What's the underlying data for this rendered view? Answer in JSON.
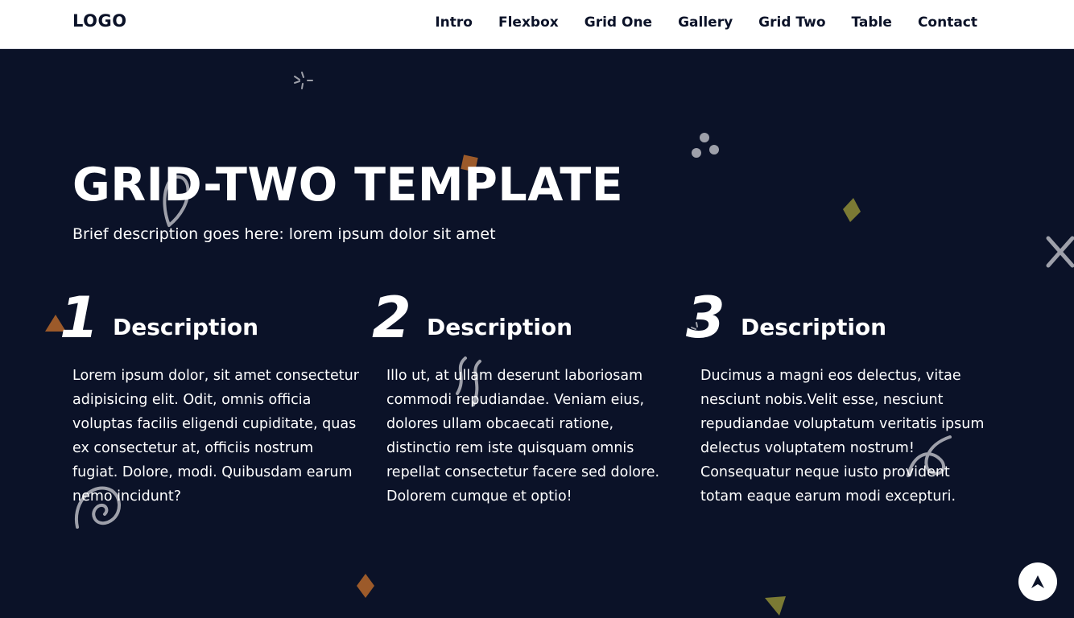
{
  "navbar": {
    "logo": "LOGO",
    "links": [
      "Intro",
      "Flexbox",
      "Grid One",
      "Gallery",
      "Grid Two",
      "Table",
      "Contact"
    ]
  },
  "hero": {
    "title": "GRID-TWO TEMPLATE",
    "subtitle": "Brief description goes here: lorem ipsum dolor sit amet"
  },
  "features": [
    {
      "number": "1",
      "title": "Description",
      "text": "Lorem ipsum dolor, sit amet consectetur adipisicing elit. Odit, omnis officia voluptas facilis eligendi cupiditate, quas ex consectetur at, officiis nostrum fugiat. Dolore, modi. Quibusdam earum nemo incidunt?"
    },
    {
      "number": "2",
      "title": "Description",
      "text": "Illo ut, at ullam deserunt laboriosam commodi repudiandae. Veniam eius, dolores ullam obcaecati ratione, distinctio rem iste quisquam omnis repellat consectetur facere sed dolore. Dolorem cumque et optio!"
    },
    {
      "number": "3",
      "title": "Description",
      "text": "Ducimus a magni eos delectus, vitae nesciunt nobis.Velit esse, nesciunt repudiandae voluptatum veritatis ipsum delectus voluptatem nostrum! Consequatur neque iusto provident totam eaque earum modi excepturi."
    }
  ],
  "scroll_top_icon": "arrow-up-icon",
  "colors": {
    "background": "#0b1228",
    "navbar": "#ffffff",
    "text": "#ffffff",
    "accent_orange": "#9c5a2a",
    "accent_olive": "#7b7a34",
    "decoration_gray": "#9ea0aa"
  }
}
